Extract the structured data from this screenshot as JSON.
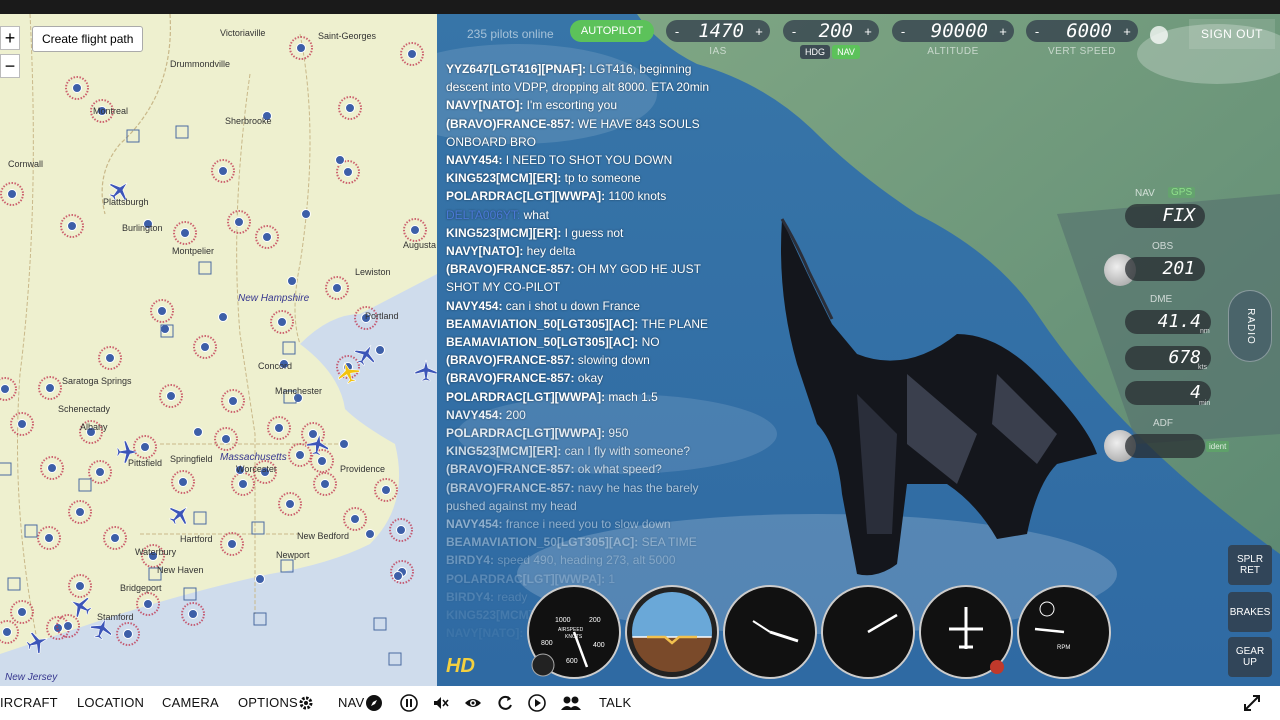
{
  "map": {
    "zoom_in": "+",
    "zoom_out": "−",
    "create_flight_path": "Create flight path",
    "labels": [
      "Victoriaville",
      "Saint-Georges",
      "Drummondville",
      "Montreal",
      "Sherbrooke",
      "Cornwall",
      "Plattsburgh",
      "Burlington",
      "Montpelier",
      "Augusta",
      "Lewiston",
      "New Hampshire",
      "Portland",
      "Concord",
      "Saratoga Springs",
      "Schenectady",
      "Manchester",
      "Albany",
      "Pittsfield",
      "Massachusetts",
      "Worcester",
      "Springfield",
      "Hartford",
      "Providence",
      "New Bedford",
      "Waterbury",
      "New Haven",
      "Newport",
      "Bridgeport",
      "Stamford",
      "New Jersey"
    ]
  },
  "hud": {
    "pilots_online": "235 pilots online",
    "autopilot": "AUTOPILOT",
    "ias": {
      "value": "1470",
      "label": "IAS"
    },
    "heading": {
      "value": "200",
      "hdg": "HDG",
      "nav": "NAV"
    },
    "altitude": {
      "value": "90000",
      "label": "ALTITUDE"
    },
    "vert_speed": {
      "value": "6000",
      "label": "VERT SPEED"
    },
    "minus": "-",
    "plus": "+",
    "sign_out": "SIGN OUT"
  },
  "chat": [
    {
      "user": "YYZ647[LGT416][PNAF]:",
      "text": " LGT416, beginning descent into VDPP, dropping alt 8000. ETA 20min",
      "opacity": 1
    },
    {
      "user": "NAVY[NATO]:",
      "text": " I'm escorting you",
      "opacity": 1
    },
    {
      "user": "(BRAVO)FRANCE-857:",
      "text": " WE HAVE 843 SOULS ONBOARD BRO",
      "opacity": 1
    },
    {
      "user": "NAVY454:",
      "text": " I NEED TO SHOT YOU DOWN",
      "opacity": 1
    },
    {
      "user": "KING523[MCM][ER]:",
      "text": " tp to someone",
      "opacity": 1
    },
    {
      "user": "POLARDRAC[LGT][WWPA]:",
      "text": " 1100 knots",
      "opacity": 1
    },
    {
      "user": "DELTA006YT:",
      "text": " what",
      "opacity": 1,
      "blue": true
    },
    {
      "user": "KING523[MCM][ER]:",
      "text": " I guess not",
      "opacity": 1
    },
    {
      "user": "NAVY[NATO]:",
      "text": " hey delta",
      "opacity": 1
    },
    {
      "user": "(BRAVO)FRANCE-857:",
      "text": " OH MY GOD HE JUST SHOT MY CO-PILOT",
      "opacity": 1
    },
    {
      "user": "NAVY454:",
      "text": " can i shot u down France",
      "opacity": 1
    },
    {
      "user": "BEAMAVIATION_50[LGT305][AC]:",
      "text": " THE PLANE",
      "opacity": 1
    },
    {
      "user": "BEAMAVIATION_50[LGT305][AC]:",
      "text": " NO",
      "opacity": 1
    },
    {
      "user": "(BRAVO)FRANCE-857:",
      "text": " slowing down",
      "opacity": 1
    },
    {
      "user": "(BRAVO)FRANCE-857:",
      "text": " okay",
      "opacity": 1
    },
    {
      "user": "POLARDRAC[LGT][WWPA]:",
      "text": " mach 1.5",
      "opacity": 1
    },
    {
      "user": "NAVY454:",
      "text": " 200",
      "opacity": 0.9
    },
    {
      "user": "POLARDRAC[LGT][WWPA]:",
      "text": " 950",
      "opacity": 0.85
    },
    {
      "user": "KING523[MCM][ER]:",
      "text": " can I fly with someone?",
      "opacity": 0.75
    },
    {
      "user": "(BRAVO)FRANCE-857:",
      "text": " ok what speed?",
      "opacity": 0.7
    },
    {
      "user": "(BRAVO)FRANCE-857:",
      "text": " navy he has the barely pushed against my head",
      "opacity": 0.6
    },
    {
      "user": "NAVY454:",
      "text": " france i need you to slow down",
      "opacity": 0.45
    },
    {
      "user": "BEAMAVIATION_50[LGT305][AC]:",
      "text": " SEA TIME",
      "opacity": 0.35
    },
    {
      "user": "BIRDY4:",
      "text": " speed 490, heading 273, alt 5000",
      "opacity": 0.28
    },
    {
      "user": "POLARDRAC[LGT][WWPA]:",
      "text": " 1",
      "opacity": 0.2
    },
    {
      "user": "BIRDY4:",
      "text": " ready",
      "opacity": 0.15
    },
    {
      "user": "KING523[MCM]:",
      "text": " ",
      "opacity": 0.1
    },
    {
      "user": "NAVY[NATO]:",
      "text": " ",
      "opacity": 0.06
    }
  ],
  "nav_panel": {
    "nav": "NAV",
    "gps": "GPS",
    "fix": "FIX",
    "obs_label": "OBS",
    "obs_value": "201",
    "dme_label": "DME",
    "dme_value": "41.4",
    "dme_unit": "nm",
    "kts_value": "678",
    "kts_unit": "kts",
    "min_value": "4",
    "min_unit": "min",
    "adf_label": "ADF",
    "ident": "ident",
    "radio": "RADIO"
  },
  "side_buttons": {
    "spoilers": [
      "SPLR",
      "RET"
    ],
    "brakes": "BRAKES",
    "gear": [
      "GEAR",
      "UP"
    ]
  },
  "gauges": {
    "airspeed_label": "AIRSPEED",
    "knots": "KNOTS",
    "airspeed_ticks": [
      "1000",
      "200",
      "800",
      "400",
      "600"
    ],
    "rpm": "RPM",
    "hd": "HD"
  },
  "toolbar": {
    "aircraft": "IRCRAFT",
    "location": "LOCATION",
    "camera": "CAMERA",
    "options": "OPTIONS",
    "nav": "NAV",
    "talk": "TALK"
  },
  "colors": {
    "autopilot_green": "#5cc25a",
    "map_bg": "#eef0cf",
    "airport_red": "#c0334d",
    "airport_blue": "#3d5fa8",
    "chat_blue_user": "#4a78d6",
    "hd_yellow": "#f4d03f"
  }
}
